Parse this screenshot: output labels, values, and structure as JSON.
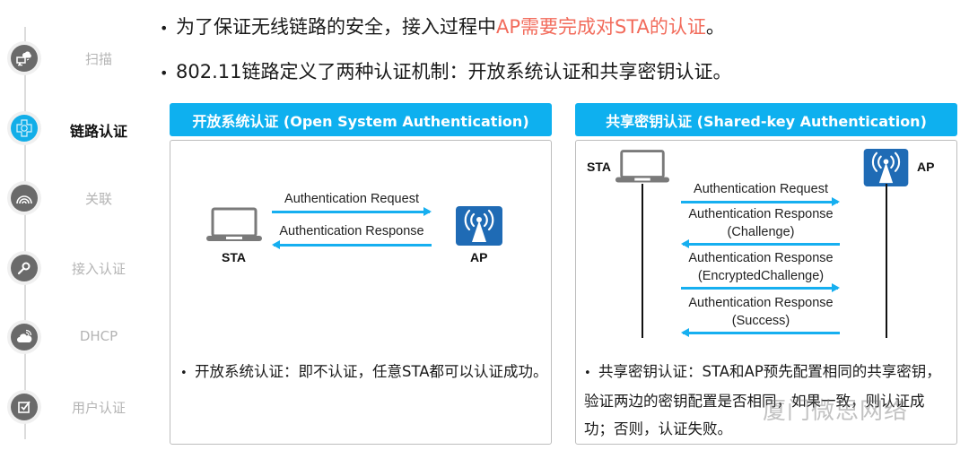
{
  "sidebar": {
    "steps": [
      {
        "label": "扫描",
        "icon": "computer-cloud-icon",
        "active": false
      },
      {
        "label": "链路认证",
        "icon": "network-cross-icon",
        "active": true
      },
      {
        "label": "关联",
        "icon": "rainbow-icon",
        "active": false
      },
      {
        "label": "接入认证",
        "icon": "key-icon",
        "active": false
      },
      {
        "label": "DHCP",
        "icon": "cloud-wifi-icon",
        "active": false
      },
      {
        "label": "用户认证",
        "icon": "checkbox-icon",
        "active": false
      }
    ]
  },
  "bullets": {
    "line1_prefix": "为了保证无线链路的安全，接入过程中",
    "line1_highlight": "AP需要完成对STA的认证",
    "line1_suffix": "。",
    "line2": "802.11链路定义了两种认证机制：开放系统认证和共享密钥认证。",
    "bullet_char": "•"
  },
  "open_system": {
    "title": "开放系统认证 (Open System Authentication)",
    "sta_label": "STA",
    "ap_label": "AP",
    "messages": [
      {
        "text": "Authentication Request",
        "direction": "to-ap"
      },
      {
        "text": "Authentication Response",
        "direction": "to-sta"
      }
    ],
    "note": "开放系统认证：即不认证，任意STA都可以认证成功。"
  },
  "shared_key": {
    "title": "共享密钥认证 (Shared-key Authentication)",
    "sta_label": "STA",
    "ap_label": "AP",
    "messages": [
      {
        "line1": "Authentication Request",
        "line2": "",
        "direction": "to-ap"
      },
      {
        "line1": "Authentication Response",
        "line2": "(Challenge)",
        "direction": "to-sta"
      },
      {
        "line1": "Authentication Response",
        "line2": "(EncryptedChallenge)",
        "direction": "to-ap"
      },
      {
        "line1": "Authentication Response",
        "line2": "(Success)",
        "direction": "to-sta"
      }
    ],
    "note": "共享密钥认证：STA和AP预先配置相同的共享密钥，验证两边的密钥配置是否相同，如果一致，则认证成功；否则，认证失败。"
  },
  "watermark": "厦门微思网络",
  "colors": {
    "accent": "#0eb0ef",
    "arrow": "#16aff0",
    "highlight": "#f26b5b",
    "ap_icon": "#1f6bb5"
  }
}
